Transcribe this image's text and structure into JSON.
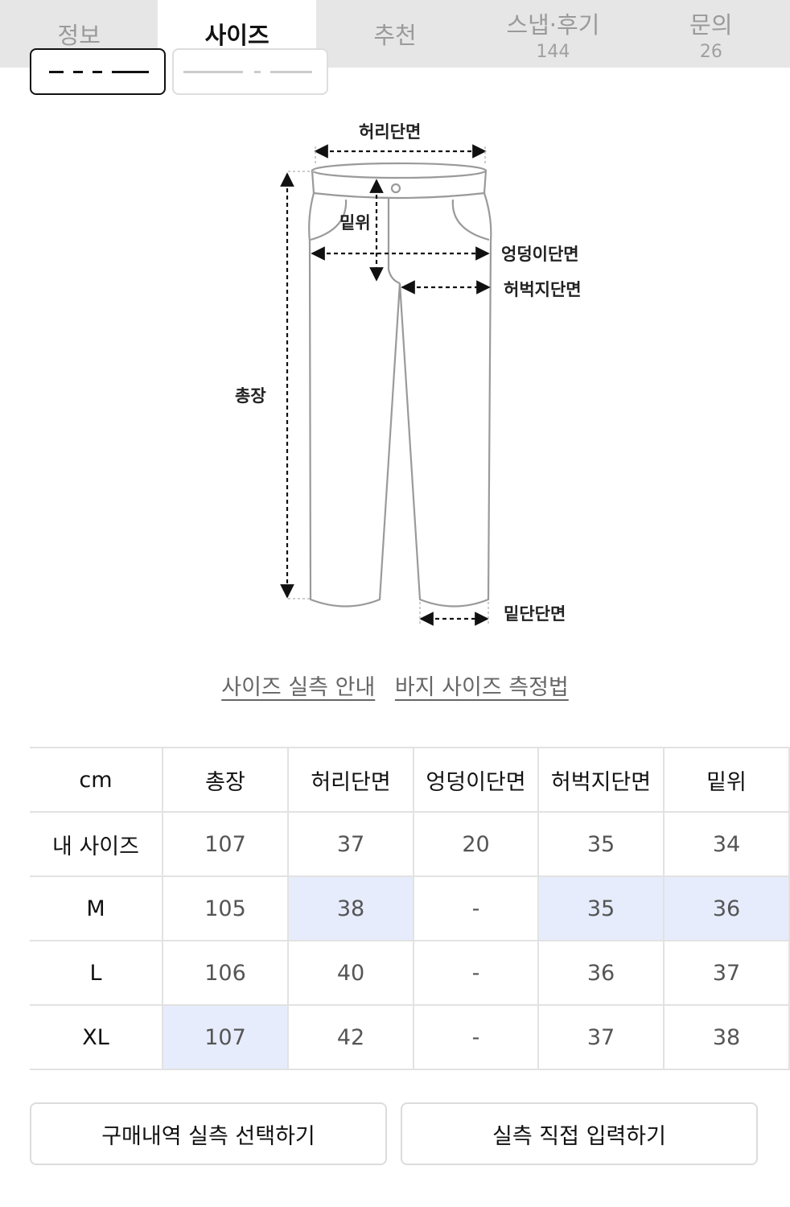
{
  "tabs": [
    {
      "label": "정보",
      "count": ""
    },
    {
      "label": "사이즈",
      "count": "",
      "active": true
    },
    {
      "label": "추천",
      "count": ""
    },
    {
      "label": "스냅·후기",
      "count": "144"
    },
    {
      "label": "문의",
      "count": "26"
    }
  ],
  "diagram": {
    "labels": {
      "waist": "허리단면",
      "rise": "밑위",
      "hip": "엉덩이단면",
      "thigh": "허벅지단면",
      "total_length": "총장",
      "hem": "밑단단면"
    }
  },
  "links": {
    "size_guide": "사이즈 실측 안내",
    "pants_measure": "바지 사이즈 측정법"
  },
  "size_table": {
    "headers": [
      "cm",
      "총장",
      "허리단면",
      "엉덩이단면",
      "허벅지단면",
      "밑위"
    ],
    "rows": [
      {
        "name": "내 사이즈",
        "values": [
          "107",
          "37",
          "20",
          "35",
          "34"
        ]
      },
      {
        "name": "M",
        "values": [
          "105",
          "38",
          "-",
          "35",
          "36"
        ]
      },
      {
        "name": "L",
        "values": [
          "106",
          "40",
          "-",
          "36",
          "37"
        ]
      },
      {
        "name": "XL",
        "values": [
          "107",
          "42",
          "-",
          "37",
          "38"
        ]
      }
    ],
    "highlight_color": "#e6ecfb"
  },
  "buttons": {
    "select_purchase": "구매내역 실측 선택하기",
    "manual_input": "실측 직접 입력하기"
  },
  "colors": {
    "tab_bar_bg": "#e6e6e6",
    "active_tab_bg": "#ffffff",
    "highlight": "#e6ecfb"
  }
}
